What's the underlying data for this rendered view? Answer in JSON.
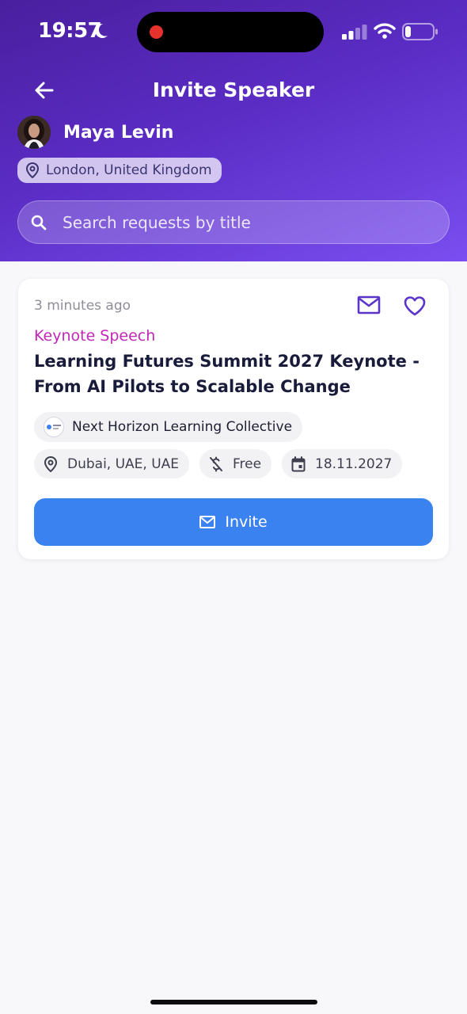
{
  "status_bar": {
    "time": "19:57",
    "icons": [
      "moon-icon",
      "signal-icon",
      "wifi-icon",
      "battery-icon"
    ]
  },
  "header": {
    "title": "Invite Speaker",
    "speaker_name": "Maya Levin",
    "location": "London, United Kingdom"
  },
  "search": {
    "placeholder": "Search requests by title"
  },
  "request_card": {
    "time_ago": "3 minutes ago",
    "category": "Keynote Speech",
    "title": "Learning Futures Summit 2027 Keynote - From AI Pilots to Scalable Change",
    "organization": "Next Horizon Learning Collective",
    "location": "Dubai, UAE, UAE",
    "fee": "Free",
    "date": "18.11.2027",
    "invite_label": "Invite"
  },
  "colors": {
    "header_gradient_start": "#4a1f9e",
    "header_gradient_end": "#7a4ef0",
    "category_accent": "#c227b8",
    "primary_button": "#3b82f1",
    "icon_accent": "#5b35c9"
  }
}
